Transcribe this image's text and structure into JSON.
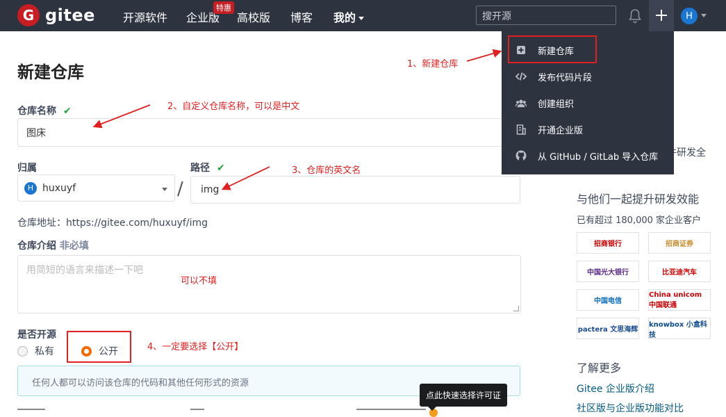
{
  "navbar": {
    "logo_letter": "G",
    "logo_text": "gitee",
    "items": [
      "开源软件",
      "企业版",
      "高校版",
      "博客",
      "我的"
    ],
    "badge": "特惠",
    "search_placeholder": "搜开源",
    "avatar_letter": "H"
  },
  "form": {
    "title": "新建仓库",
    "repo_name_label": "仓库名称",
    "repo_name_value": "图床",
    "owner_label": "归属",
    "owner_value": "huxuyf",
    "owner_avatar": "H",
    "slash": "/",
    "path_label": "路径",
    "path_value": "img",
    "address": "仓库地址：https://gitee.com/huxuyf/img",
    "intro_label": "仓库介绍",
    "intro_optional": "非必填",
    "intro_placeholder": "用简短的语言来描述一下吧",
    "visibility_label": "是否开源",
    "private_label": "私有",
    "public_label": "公开",
    "info_text": "任何人都可以访问该仓库的代码和其他任何形式的资源",
    "check": "✔"
  },
  "tooltip": "点此快速选择许可证",
  "annotations": {
    "a1": "1、新建仓库",
    "a2": "2、自定义仓库名称，可以是中文",
    "a3": "3、仓库的英文名",
    "a_optional": "可以不填",
    "a4": "4、一定要选择【公开】"
  },
  "dropdown": [
    {
      "label": "新建仓库",
      "icon": "plus-square-icon"
    },
    {
      "label": "发布代码片段",
      "icon": "code-icon"
    },
    {
      "label": "创建组织",
      "icon": "users-icon"
    },
    {
      "label": "开通企业版",
      "icon": "building-icon"
    },
    {
      "label": "从 GitHub / GitLab 导入仓库",
      "icon": "github-icon"
    }
  ],
  "sidebar": {
    "partial_text": "件研发全",
    "heading": "与他们一起提升研发效能",
    "customers": "已有超过 180,000 家企业客户",
    "logos": [
      "招商银行",
      "招商证券",
      "中国光大银行",
      "比亚迪汽车",
      "中国电信",
      "China unicom 中国联通",
      "pactera 文思海辉",
      "knowbox 小盒科技"
    ],
    "learn_more": "了解更多",
    "links": [
      "Gitee 企业版介绍",
      "社区版与企业版功能对比"
    ]
  },
  "colors": {
    "navbar": "#2e3340",
    "accent_red": "#e02020",
    "radio_orange": "#f56a00",
    "check_green": "#21a336"
  }
}
